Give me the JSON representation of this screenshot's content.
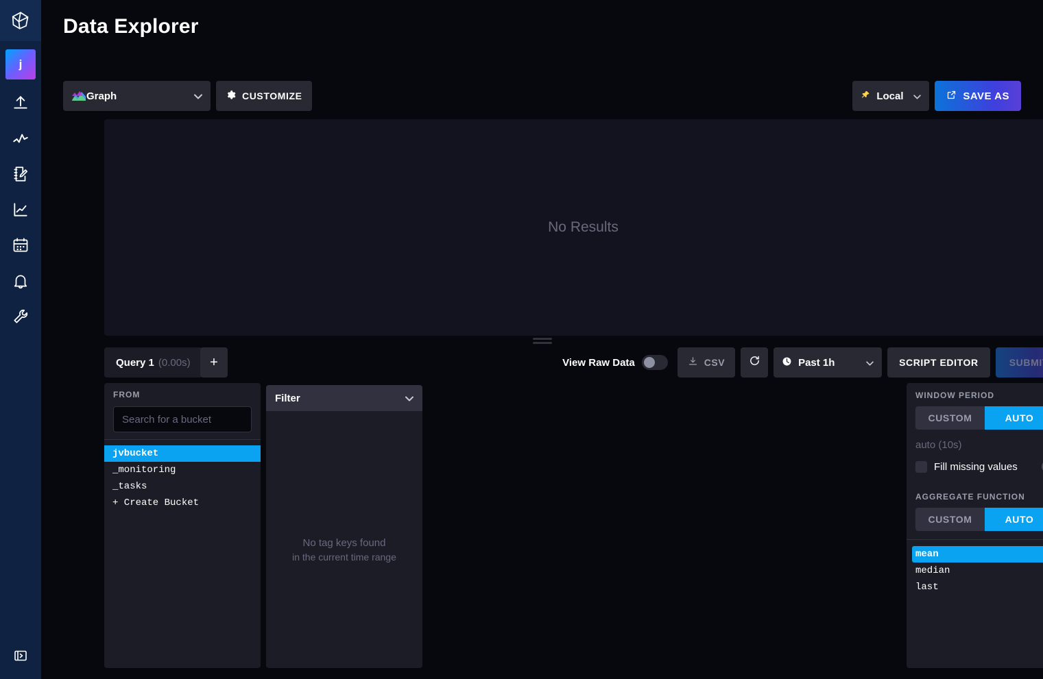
{
  "nav": {
    "logo_icon": "influxdb-logo-icon",
    "avatar_label": "j",
    "items": [
      {
        "icon": "upload-data-icon",
        "name": "load-data"
      },
      {
        "icon": "pulse-explore-icon",
        "name": "explore"
      },
      {
        "icon": "notebook-edit-icon",
        "name": "notebooks"
      },
      {
        "icon": "line-chart-icon",
        "name": "dashboards"
      },
      {
        "icon": "calendar-tasks-icon",
        "name": "tasks"
      },
      {
        "icon": "bell-alerts-icon",
        "name": "alerts"
      },
      {
        "icon": "wrench-settings-icon",
        "name": "settings"
      }
    ],
    "expand_icon": "panel-expand-icon"
  },
  "header": {
    "title": "Data Explorer"
  },
  "viz_toolbar": {
    "view_type": "Graph",
    "view_type_icon": "graph-type-icon",
    "customize_label": "CUSTOMIZE",
    "customize_icon": "gear-icon",
    "local_label": "Local",
    "local_icon": "pin-icon",
    "save_as_label": "SAVE AS",
    "save_as_icon": "external-link-icon"
  },
  "graph_panel": {
    "empty_message": "No Results"
  },
  "query_toolbar": {
    "query_tab_name": "Query 1",
    "query_tab_duration": "(0.00s)",
    "add_query_label": "+",
    "raw_data_label": "View Raw Data",
    "raw_data_on": false,
    "csv_label": "CSV",
    "csv_icon": "download-icon",
    "refresh_icon": "refresh-icon",
    "time_range": "Past 1h",
    "time_range_icon": "clock-icon",
    "script_editor_label": "SCRIPT EDITOR",
    "submit_label": "SUBMIT",
    "submit_enabled": false
  },
  "from_panel": {
    "header": "FROM",
    "search_placeholder": "Search for a bucket",
    "search_value": "",
    "buckets": [
      {
        "label": "jvbucket",
        "selected": true
      },
      {
        "label": "_monitoring",
        "selected": false
      },
      {
        "label": "_tasks",
        "selected": false
      }
    ],
    "create_bucket_label": "+ Create Bucket"
  },
  "filter_panel": {
    "title": "Filter",
    "empty_line_1": "No tag keys found",
    "empty_line_2": "in the current time range"
  },
  "settings_panel": {
    "window_period_label": "WINDOW PERIOD",
    "window_custom_label": "CUSTOM",
    "window_auto_label": "AUTO",
    "window_mode": "AUTO",
    "auto_value": "auto (10s)",
    "fill_missing_label": "Fill missing values",
    "fill_missing_checked": false,
    "help_icon": "question-mark-icon",
    "aggregate_label": "AGGREGATE FUNCTION",
    "agg_custom_label": "CUSTOM",
    "agg_auto_label": "AUTO",
    "agg_mode": "AUTO",
    "functions": [
      {
        "label": "mean",
        "selected": true
      },
      {
        "label": "median",
        "selected": false
      },
      {
        "label": "last",
        "selected": false
      }
    ]
  },
  "colors": {
    "accent_blue": "#0aa3f2",
    "nav_bg": "#0f2241",
    "panel_bg": "#1c1c27",
    "page_bg": "#07070e"
  }
}
